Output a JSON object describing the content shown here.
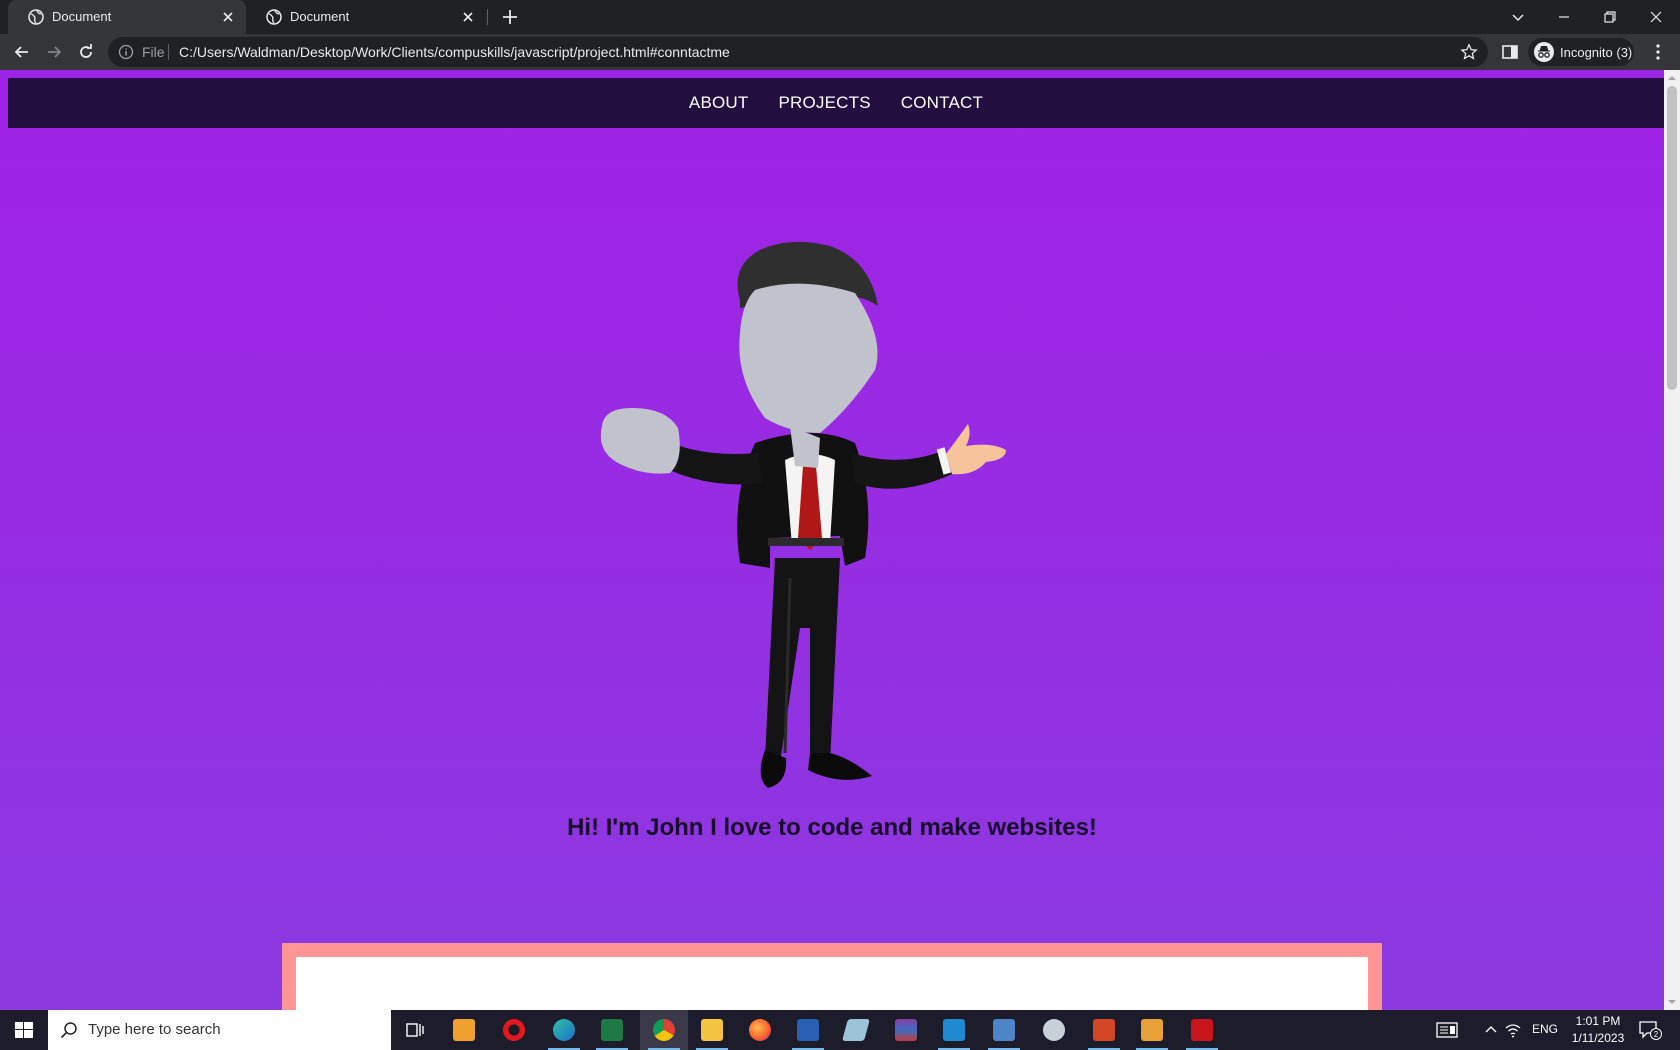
{
  "browser": {
    "tabs": [
      {
        "title": "Document",
        "active": true
      },
      {
        "title": "Document",
        "active": false
      }
    ],
    "address": {
      "scheme_label": "File",
      "url": "C:/Users/Waldman/Desktop/Work/Clients/compuskills/javascript/project.html#conntactme"
    },
    "profile_label": "Incognito (3)"
  },
  "page": {
    "nav": [
      {
        "label": "ABOUT"
      },
      {
        "label": "PROJECTS"
      },
      {
        "label": "CONTACT"
      }
    ],
    "hero_text": "Hi! I'm John I love to code and make websites!",
    "colors": {
      "background_top": "#a121e6",
      "background_bottom": "#8b3ae0",
      "navbar": "#220f40",
      "card_border": "#ff9494"
    }
  },
  "taskbar": {
    "search_placeholder": "Type here to search",
    "apps": [
      "task-view-icon",
      "media-player-icon",
      "opera-icon",
      "edge-icon",
      "excel-icon",
      "chrome-icon",
      "file-explorer-icon",
      "firefox-icon",
      "word-icon",
      "notes-icon",
      "winrar-icon",
      "vscode-icon",
      "image-viewer-icon",
      "paint-icon",
      "powerpoint-icon",
      "outlook-icon",
      "acrobat-icon"
    ],
    "language": "ENG",
    "time": "1:01 PM",
    "date": "1/11/2023",
    "notification_count": "2"
  }
}
